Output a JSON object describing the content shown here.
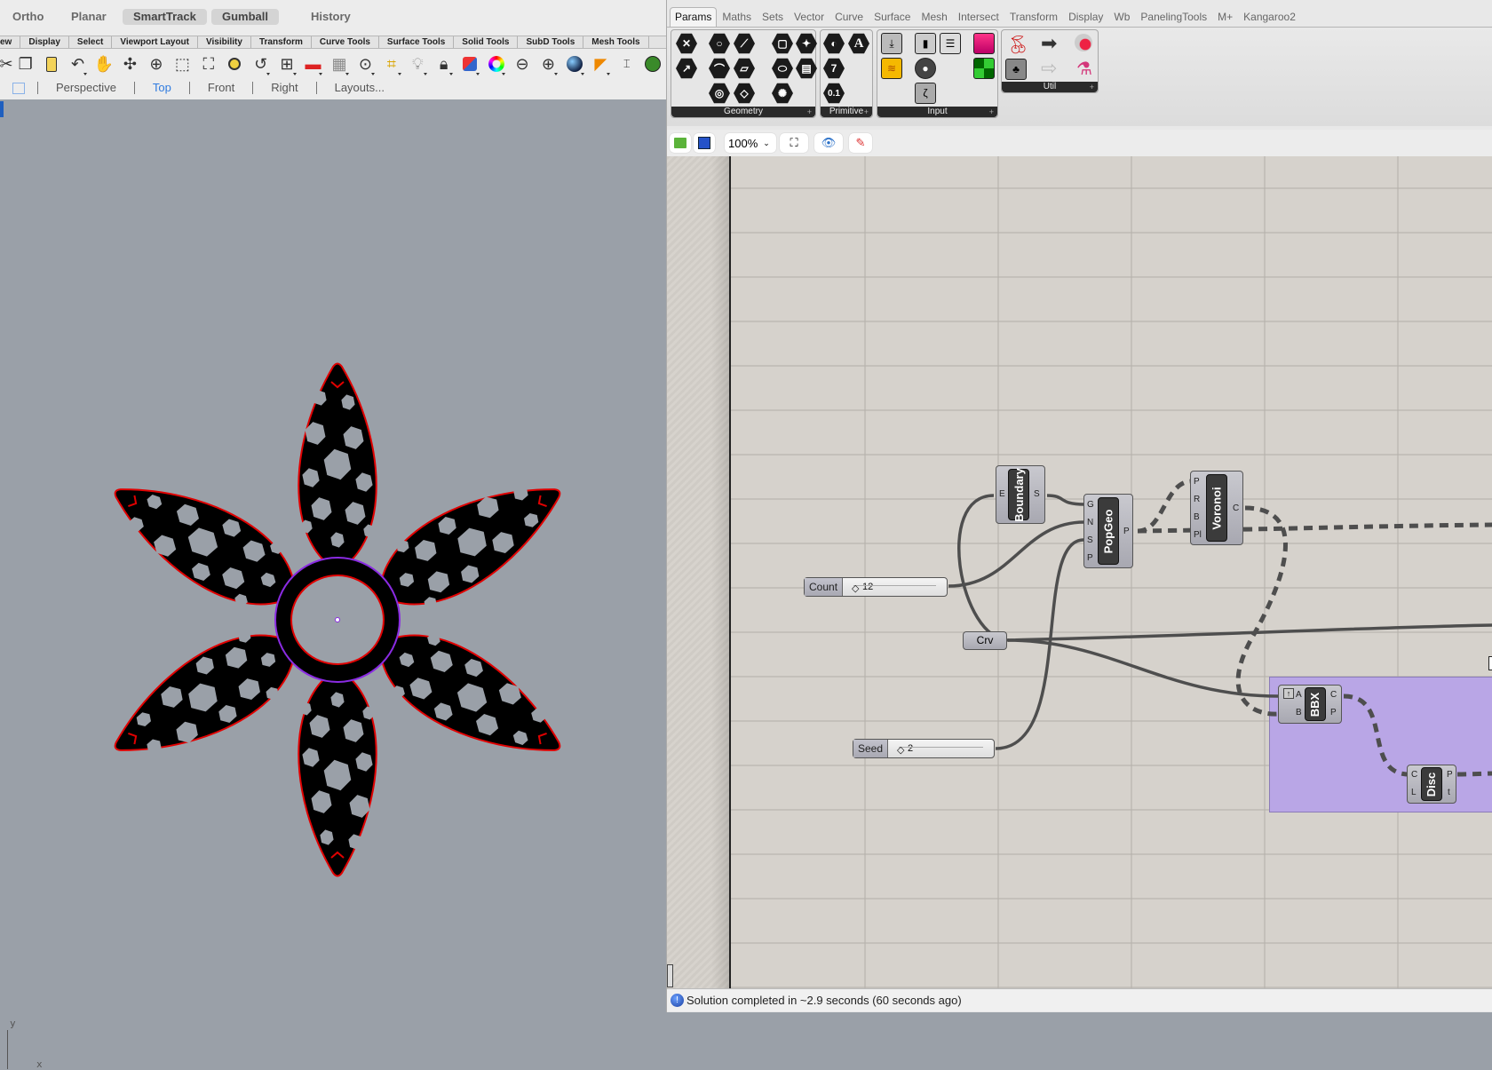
{
  "rhino": {
    "toggles": [
      {
        "label": "Ortho",
        "on": false
      },
      {
        "label": "Planar",
        "on": false
      },
      {
        "label": "SmartTrack",
        "on": true
      },
      {
        "label": "Gumball",
        "on": true
      },
      {
        "label": "History",
        "on": false
      }
    ],
    "toolbar_tabs": [
      "ew",
      "Display",
      "Select",
      "Viewport Layout",
      "Visibility",
      "Transform",
      "Curve Tools",
      "Surface Tools",
      "Solid Tools",
      "SubD Tools",
      "Mesh Tools"
    ],
    "toolbar_icons": [
      "cut-icon",
      "copy-icon",
      "paste-icon",
      "undo-icon",
      "pan-icon",
      "rotate-view-icon",
      "zoom-icon",
      "zoom-window-icon",
      "zoom-extents-icon",
      "zoom-selected-icon",
      "undo-view-icon",
      "four-viewports-icon",
      "car-icon",
      "grid-icon",
      "circle-point-icon",
      "osnap-icon",
      "light-icon",
      "lock-icon",
      "layer-icon",
      "color-wheel-icon",
      "shaded-sphere-icon",
      "wire-sphere-icon",
      "render-sphere-icon",
      "cone-icon",
      "dimension-icon",
      "grasshopper-icon"
    ],
    "viewport_tabs": [
      {
        "label": "Perspective",
        "active": false
      },
      {
        "label": "Top",
        "active": true
      },
      {
        "label": "Front",
        "active": false
      },
      {
        "label": "Right",
        "active": false
      },
      {
        "label": "Layouts...",
        "active": false
      }
    ],
    "axis": {
      "y": "y",
      "x": "x"
    },
    "flower": {
      "petals": 6,
      "colors": {
        "fill": "#000000",
        "outline": "#e00000",
        "ring": "#8a2be2"
      }
    }
  },
  "grasshopper": {
    "tabs": [
      "Params",
      "Maths",
      "Sets",
      "Vector",
      "Curve",
      "Surface",
      "Mesh",
      "Intersect",
      "Transform",
      "Display",
      "Wb",
      "PanelingTools",
      "M+",
      "Kangaroo2"
    ],
    "active_tab": "Params",
    "panels": [
      {
        "label": "Geometry"
      },
      {
        "label": "Primitive"
      },
      {
        "label": "Input"
      },
      {
        "label": "Util"
      }
    ],
    "toolbar": {
      "zoom": "100%"
    },
    "nodes": {
      "boundary": {
        "title": "Boundary",
        "inputs": [
          "E"
        ],
        "outputs": [
          "S"
        ]
      },
      "popgeo": {
        "title": "PopGeo",
        "inputs": [
          "G",
          "N",
          "S",
          "P"
        ],
        "outputs": [
          "P"
        ]
      },
      "voronoi": {
        "title": "Voronoi",
        "inputs": [
          "P",
          "R",
          "B",
          "Pl"
        ],
        "outputs": [
          "C"
        ]
      },
      "bbx": {
        "title": "BBX",
        "inputs": [
          "A",
          "B"
        ],
        "outputs": [
          "C",
          "P"
        ]
      },
      "disc": {
        "title": "Disc",
        "inputs": [
          "C",
          "L"
        ],
        "outputs": [
          "P",
          "t"
        ]
      },
      "crv": {
        "title": "Crv"
      },
      "count": {
        "label": "Count",
        "value": "12"
      },
      "seed": {
        "label": "Seed",
        "value": "2"
      }
    },
    "group_color": "#b9a6e6",
    "status": "Solution completed in ~2.9 seconds (60 seconds ago)"
  }
}
